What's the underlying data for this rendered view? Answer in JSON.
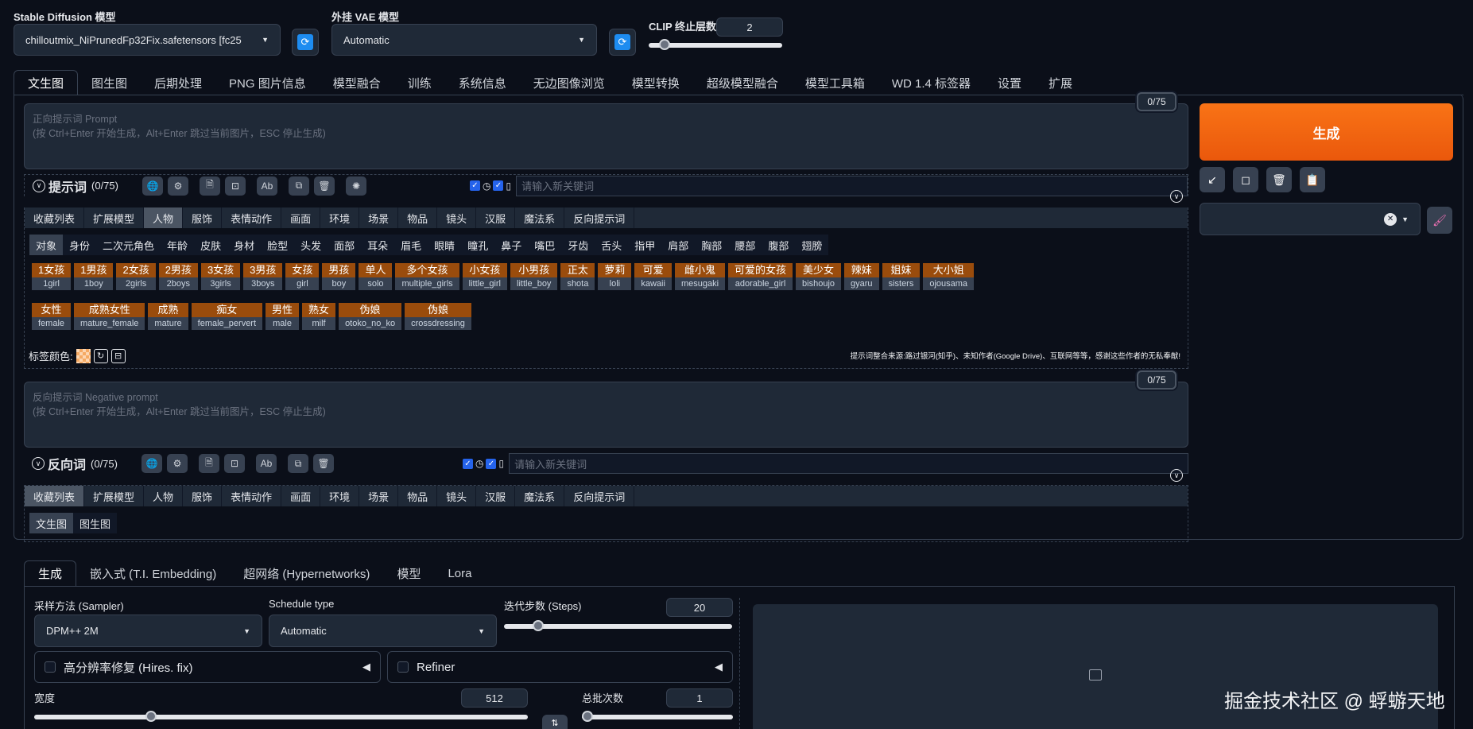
{
  "header": {
    "sd_model_label": "Stable Diffusion 模型",
    "sd_model_value": "chilloutmix_NiPrunedFp32Fix.safetensors [fc25",
    "vae_label": "外挂 VAE 模型",
    "vae_value": "Automatic",
    "clip_label": "CLIP 终止层数",
    "clip_value": "2",
    "clip_fraction": 0.083
  },
  "main_tabs": [
    "文生图",
    "图生图",
    "后期处理",
    "PNG 图片信息",
    "模型融合",
    "训练",
    "系统信息",
    "无边图像浏览",
    "模型转换",
    "超级模型融合",
    "模型工具箱",
    "WD 1.4 标签器",
    "设置",
    "扩展"
  ],
  "prompt": {
    "counter": "0/75",
    "placeholder_line1": "正向提示词 Prompt",
    "placeholder_line2": "(按 Ctrl+Enter 开始生成，Alt+Enter 跳过当前图片，ESC 停止生成)",
    "title": "提示词",
    "title_count": "(0/75)",
    "search_placeholder": "请输入新关键词"
  },
  "tag_categories": [
    "收藏列表",
    "扩展模型",
    "人物",
    "服饰",
    "表情动作",
    "画面",
    "环境",
    "场景",
    "物品",
    "镜头",
    "汉服",
    "魔法系",
    "反向提示词"
  ],
  "tag_subcategories": [
    "对象",
    "身份",
    "二次元角色",
    "年龄",
    "皮肤",
    "身材",
    "脸型",
    "头发",
    "面部",
    "耳朵",
    "眉毛",
    "眼睛",
    "瞳孔",
    "鼻子",
    "嘴巴",
    "牙齿",
    "舌头",
    "指甲",
    "肩部",
    "胸部",
    "腰部",
    "腹部",
    "翅膀"
  ],
  "chips_row1": [
    {
      "cn": "1女孩",
      "en": "1girl"
    },
    {
      "cn": "1男孩",
      "en": "1boy"
    },
    {
      "cn": "2女孩",
      "en": "2girls"
    },
    {
      "cn": "2男孩",
      "en": "2boys"
    },
    {
      "cn": "3女孩",
      "en": "3girls"
    },
    {
      "cn": "3男孩",
      "en": "3boys"
    },
    {
      "cn": "女孩",
      "en": "girl"
    },
    {
      "cn": "男孩",
      "en": "boy"
    },
    {
      "cn": "单人",
      "en": "solo"
    },
    {
      "cn": "多个女孩",
      "en": "multiple_girls"
    },
    {
      "cn": "小女孩",
      "en": "little_girl"
    },
    {
      "cn": "小男孩",
      "en": "little_boy"
    },
    {
      "cn": "正太",
      "en": "shota"
    },
    {
      "cn": "萝莉",
      "en": "loli"
    },
    {
      "cn": "可爱",
      "en": "kawaii"
    },
    {
      "cn": "雌小鬼",
      "en": "mesugaki"
    },
    {
      "cn": "可爱的女孩",
      "en": "adorable_girl"
    },
    {
      "cn": "美少女",
      "en": "bishoujo"
    },
    {
      "cn": "辣妹",
      "en": "gyaru"
    },
    {
      "cn": "姐妹",
      "en": "sisters"
    },
    {
      "cn": "大小姐",
      "en": "ojousama"
    }
  ],
  "chips_row2": [
    {
      "cn": "女性",
      "en": "female"
    },
    {
      "cn": "成熟女性",
      "en": "mature_female"
    },
    {
      "cn": "成熟",
      "en": "mature"
    },
    {
      "cn": "痴女",
      "en": "female_pervert"
    },
    {
      "cn": "男性",
      "en": "male"
    },
    {
      "cn": "熟女",
      "en": "milf"
    },
    {
      "cn": "伪娘",
      "en": "otoko_no_ko"
    },
    {
      "cn": "伪娘",
      "en": "crossdressing"
    }
  ],
  "tag_color_label": "标签颜色:",
  "credit_text": "提示词整合来源:路过银河(知乎)、未知作者(Google Drive)、互联网等等，感谢这些作者的无私奉献!",
  "negative": {
    "counter": "0/75",
    "placeholder_line1": "反向提示词 Negative prompt",
    "placeholder_line2": "(按 Ctrl+Enter 开始生成，Alt+Enter 跳过当前图片，ESC 停止生成)",
    "title": "反向词",
    "title_count": "(0/75)",
    "search_placeholder": "请输入新关键词"
  },
  "neg_subtabs": [
    "文生图",
    "图生图"
  ],
  "generate_label": "生成",
  "tool_icons": [
    "↙",
    "◻",
    "🗑",
    "📋"
  ],
  "bottom_tabs": [
    "生成",
    "嵌入式 (T.I. Embedding)",
    "超网络 (Hypernetworks)",
    "模型",
    "Lora"
  ],
  "settings": {
    "sampler_label": "采样方法 (Sampler)",
    "sampler_value": "DPM++ 2M",
    "schedule_label": "Schedule type",
    "schedule_value": "Automatic",
    "steps_label": "迭代步数 (Steps)",
    "steps_value": "20",
    "steps_fraction": 0.133,
    "hires_label": "高分辨率修复 (Hires. fix)",
    "refiner_label": "Refiner",
    "width_label": "宽度",
    "width_value": "512",
    "width_fraction": 0.23,
    "batch_count_label": "总批次数",
    "batch_count_value": "1",
    "batch_fraction": 0.0
  },
  "watermark": "掘金技术社区 @ 蜉蝣天地"
}
